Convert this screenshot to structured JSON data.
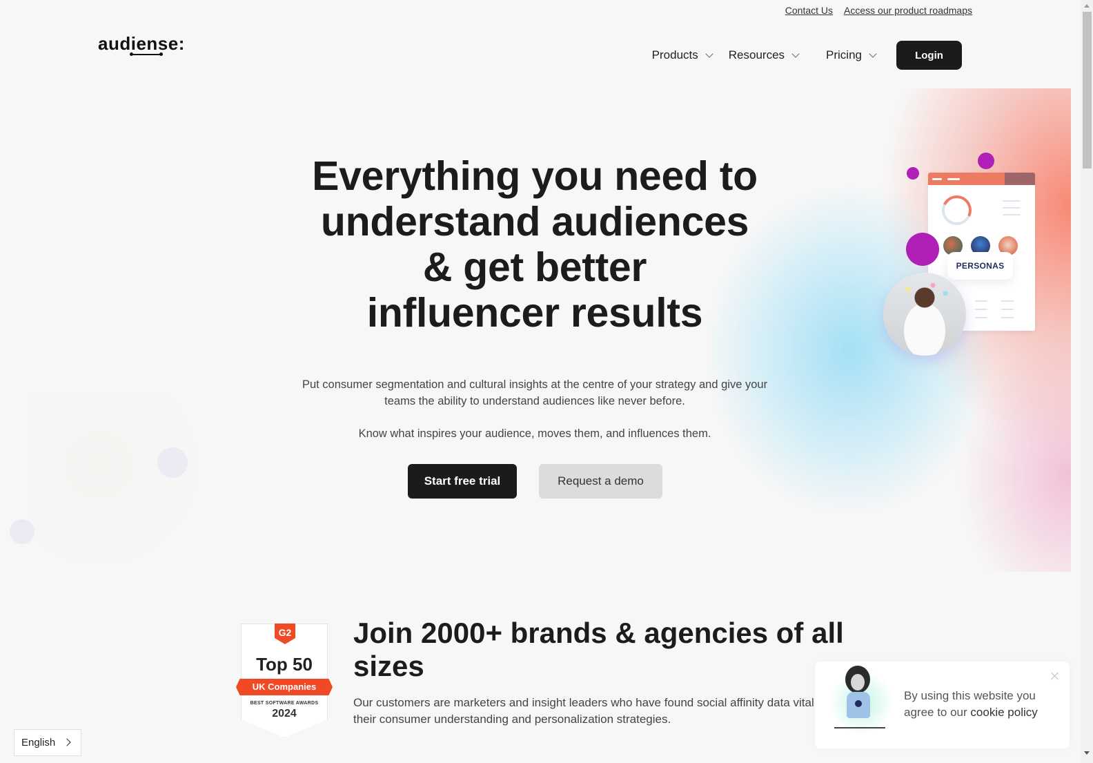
{
  "util_links": {
    "contact": "Contact Us",
    "roadmaps": "Access our product roadmaps"
  },
  "header": {
    "logo_text": "audiense:",
    "nav": [
      {
        "label": "Products",
        "icon": "chevron-down-icon"
      },
      {
        "label": "Resources",
        "icon": "chevron-down-icon"
      },
      {
        "label": "Pricing",
        "icon": "chevron-down-icon"
      }
    ],
    "login_label": "Login"
  },
  "hero": {
    "title_lines": [
      "Everything you need to",
      "understand audiences",
      "& get better",
      "influencer results"
    ],
    "paragraph_1": "Put consumer segmentation and cultural insights at the centre of your strategy and give your teams the ability to understand audiences like never before.",
    "paragraph_2": "Know what inspires your audience, moves them, and influences them.",
    "primary_cta": "Start free trial",
    "secondary_cta": "Request a demo",
    "illustration": {
      "label": "PERSONAS"
    }
  },
  "colors": {
    "primary_button": "#1b1b1b",
    "secondary_button": "#dcdcdc",
    "accent_purple": "#b01fb8",
    "accent_coral": "#ec7b61",
    "g2_red": "#ef4a25"
  },
  "badge": {
    "brand": "G2",
    "title": "Top 50",
    "ribbon": "UK Companies",
    "subtitle": "BEST SOFTWARE AWARDS",
    "year": "2024"
  },
  "brands": {
    "title": "Join 2000+ brands & agencies of all sizes",
    "description": "Our customers are marketers and insight leaders who have found social affinity data vital to their consumer understanding and personalization strategies."
  },
  "cookie": {
    "text": "By using this website you agree to our",
    "link": "cookie policy"
  },
  "language": {
    "selected": "English"
  }
}
